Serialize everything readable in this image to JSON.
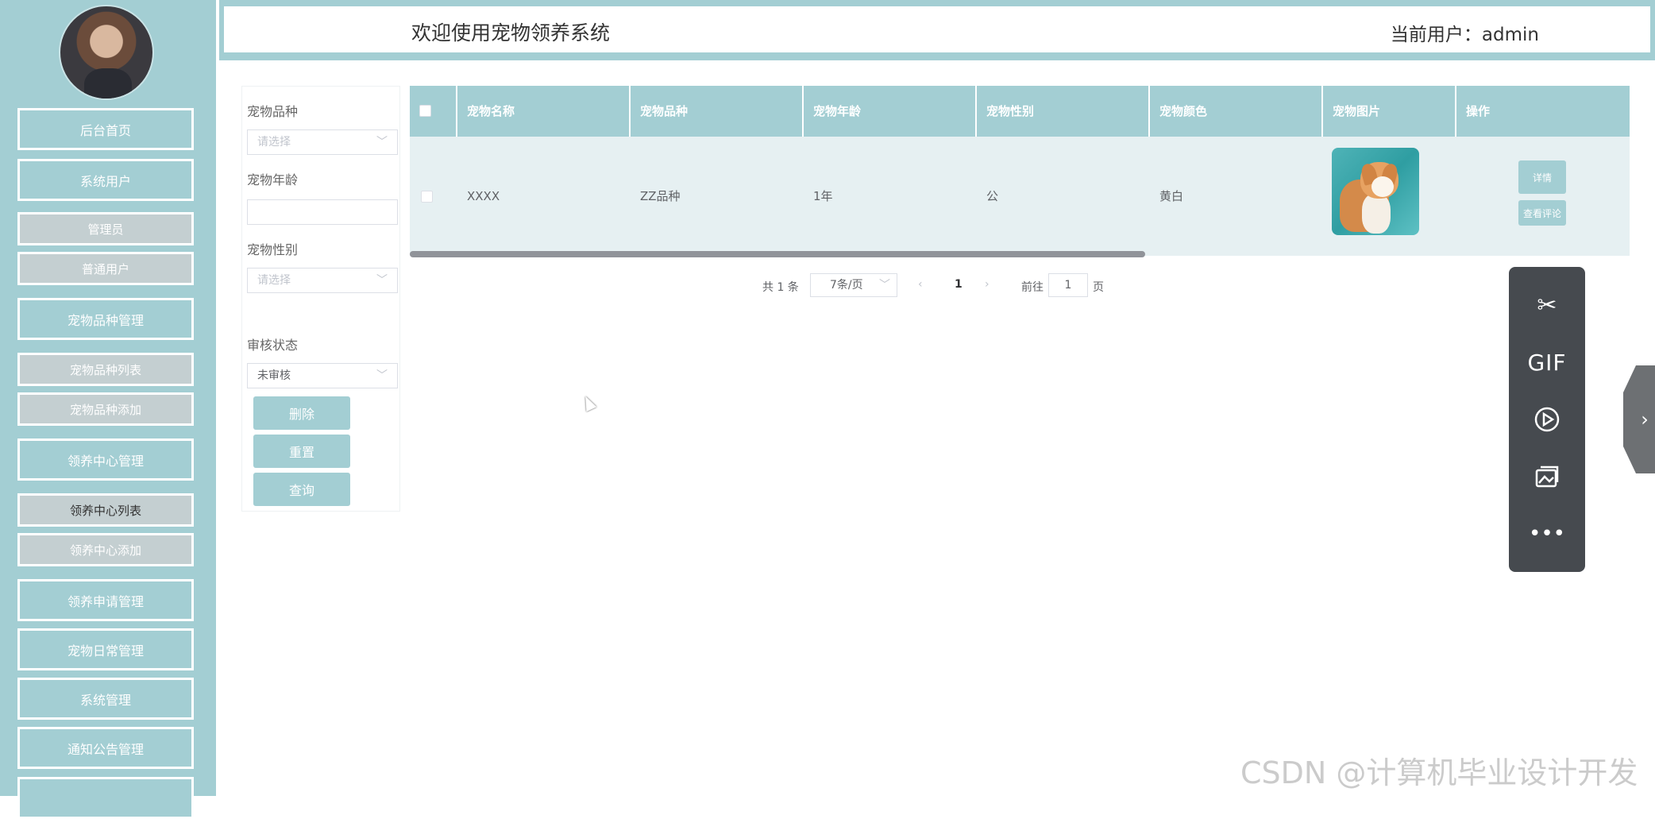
{
  "header": {
    "title": "欢迎使用宠物领养系统",
    "user_label": "当前用户：admin"
  },
  "sidebar": {
    "items": [
      {
        "label": "后台首页"
      },
      {
        "label": "系统用户"
      },
      {
        "label": "管理员"
      },
      {
        "label": "普通用户"
      },
      {
        "label": "宠物品种管理"
      },
      {
        "label": "宠物品种列表"
      },
      {
        "label": "宠物品种添加"
      },
      {
        "label": "领养中心管理"
      },
      {
        "label": "领养中心列表"
      },
      {
        "label": "领养中心添加"
      },
      {
        "label": "领养申请管理"
      },
      {
        "label": "宠物日常管理"
      },
      {
        "label": "系统管理"
      },
      {
        "label": "通知公告管理"
      }
    ]
  },
  "filter": {
    "breed_label": "宠物品种",
    "breed_placeholder": "请选择",
    "age_label": "宠物年龄",
    "gender_label": "宠物性别",
    "gender_placeholder": "请选择",
    "audit_label": "审核状态",
    "audit_value": "未审核",
    "delete_label": "删除",
    "reset_label": "重置",
    "query_label": "查询"
  },
  "table": {
    "columns": [
      "宠物名称",
      "宠物品种",
      "宠物年龄",
      "宠物性别",
      "宠物颜色",
      "宠物图片",
      "操作"
    ],
    "rows": [
      {
        "name": "XXXX",
        "breed": "ZZ品种",
        "age": "1年",
        "gender": "公",
        "color": "黄白",
        "actions": {
          "detail": "详情",
          "comments": "查看评论"
        }
      }
    ]
  },
  "pager": {
    "total": "共 1 条",
    "page_size": "7条/页",
    "current": "1",
    "goto_label": "前往",
    "goto_value": "1",
    "page_suffix": "页"
  },
  "toolbar": {
    "gif_label": "GIF"
  },
  "watermark": "CSDN @计算机毕业设计开发"
}
